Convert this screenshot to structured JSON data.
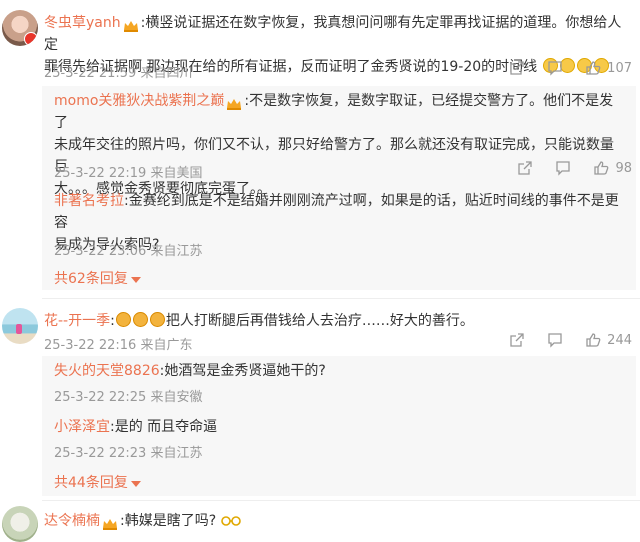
{
  "comments": [
    {
      "user": "冬虫草yanh",
      "text": ":横竖说证据还在数字恢复，我真想问问哪有先定罪再找证据的道理。你想给人定罪得先给证据啊 那边现在给的所有证据，反而证明了金秀贤说的19-20的时间线",
      "text_line1": ":横竖说证据还在数字恢复，我真想问问哪有先定罪再找证据的道理。你想给人定",
      "text_line2": "罪得先给证据啊 那边现在给的所有证据，反而证明了金秀贤说的19-20的时间线",
      "time": "25-3-22 21:59 来自四川",
      "likes": "107",
      "replies": [
        {
          "user": "momo关雅狄决战紫荆之巅",
          "text_line1": ":不是数字恢复，是数字取证，已经提交警方了。他们不是发了",
          "text_line2": "未成年交往的照片吗，你们又不认，那只好给警方了。那么就还没有取证完成，只能说数量巨",
          "text_line3": "大。。。感觉金秀贤要彻底完蛋了。。",
          "time": "25-3-22 22:19 来自美国",
          "likes": "98"
        },
        {
          "user": "非著名考拉",
          "text_line1": ":金赛纶到底是不是结婚并刚刚流产过啊，如果是的话，贴近时间线的事件不是更容",
          "text_line2": "易成为导火索吗?",
          "time": "25-3-22 23:06 来自江苏"
        }
      ],
      "more": "共62条回复"
    },
    {
      "user": "花--开一季",
      "text": "把人打断腿后再借钱给人去治疗……好大的善行。",
      "time": "25-3-22 22:16 来自广东",
      "likes": "244",
      "replies": [
        {
          "user": "失火的天堂8826",
          "text": ":她酒驾是金秀贤逼她干的?",
          "time": "25-3-22 22:25 来自安徽"
        },
        {
          "user": "小泽泽宜",
          "text": ":是的 而且夺命逼",
          "time": "25-3-22 22:23 来自江苏"
        }
      ],
      "more": "共44条回复"
    },
    {
      "user": "达令楠楠",
      "text": ":韩媒是瞎了吗?"
    }
  ],
  "colors": {
    "username": "#eb7350",
    "meta": "#999999",
    "reply_bg": "#f7f7f7"
  },
  "icons": [
    "share-icon",
    "comment-icon",
    "like-icon",
    "crown-badge-icon",
    "sweat-emoji",
    "kiss-emoji",
    "glasses-emoji",
    "chevron-down-icon"
  ]
}
